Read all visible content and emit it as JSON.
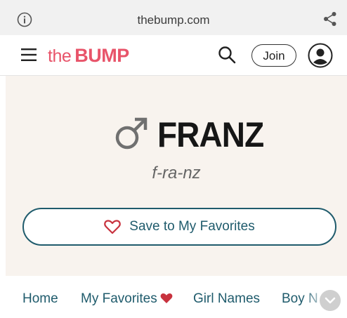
{
  "browser": {
    "url": "thebump.com",
    "icons": {
      "info": "info-icon",
      "share": "share-icon"
    }
  },
  "header": {
    "logo_the": "the",
    "logo_bump": "BUMP",
    "join_label": "Join",
    "icons": {
      "menu": "hamburger-menu-icon",
      "search": "search-icon",
      "account": "account-avatar-icon"
    },
    "brand_color": "#e8546a"
  },
  "name_card": {
    "name": "FRANZ",
    "pronunciation": "f-ra-nz",
    "gender_icon": "male-symbol-icon",
    "favorite_button_label": "Save to My Favorites",
    "accent_color": "#1f5b6c",
    "heart_color": "#c8323e",
    "background_color": "#f8f3ee"
  },
  "tabs": [
    {
      "label": "Home"
    },
    {
      "label": "My Favorites"
    },
    {
      "label": "Girl Names"
    },
    {
      "label": "Boy Names"
    }
  ]
}
